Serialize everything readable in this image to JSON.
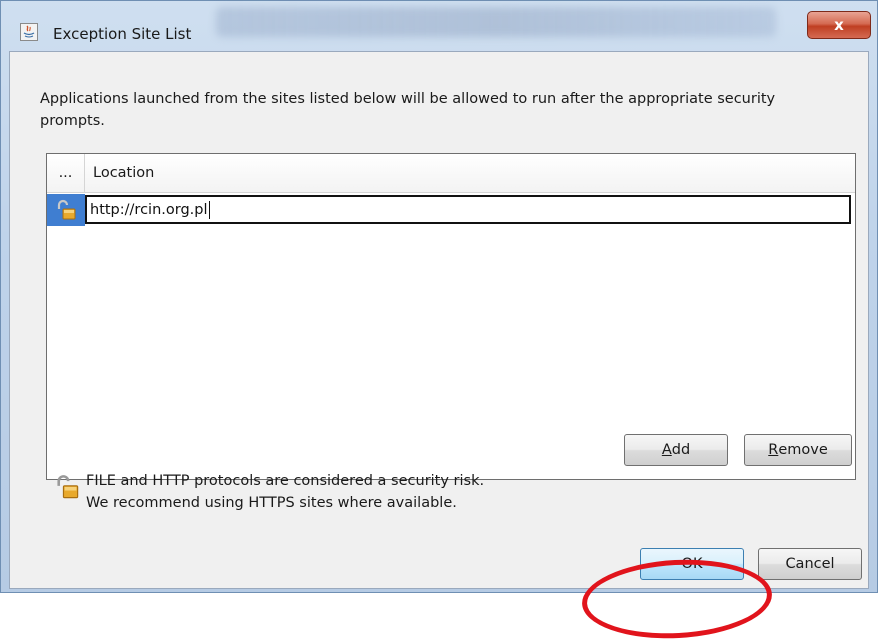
{
  "window": {
    "title": "Exception Site List",
    "close_label": "x"
  },
  "instructions": "Applications launched from the sites listed below will be allowed to run after the appropriate security prompts.",
  "table": {
    "columns": [
      "...",
      "Location"
    ],
    "rows": [
      {
        "location": "http://rcin.org.pl"
      }
    ]
  },
  "buttons": {
    "add_prefix": "A",
    "add_rest": "dd",
    "remove_prefix": "R",
    "remove_rest": "emove",
    "ok": "OK",
    "cancel": "Cancel"
  },
  "warning": {
    "line1": "FILE and HTTP protocols are considered a security risk.",
    "line2": "We recommend using HTTPS sites where available."
  },
  "icons": {
    "app": "java-icon",
    "row": "unlocked-padlock-icon",
    "warning": "unlocked-padlock-icon"
  },
  "colors": {
    "selection": "#3f7ed1",
    "annotation": "#e1141c",
    "ok_border": "#3c7fb1"
  }
}
